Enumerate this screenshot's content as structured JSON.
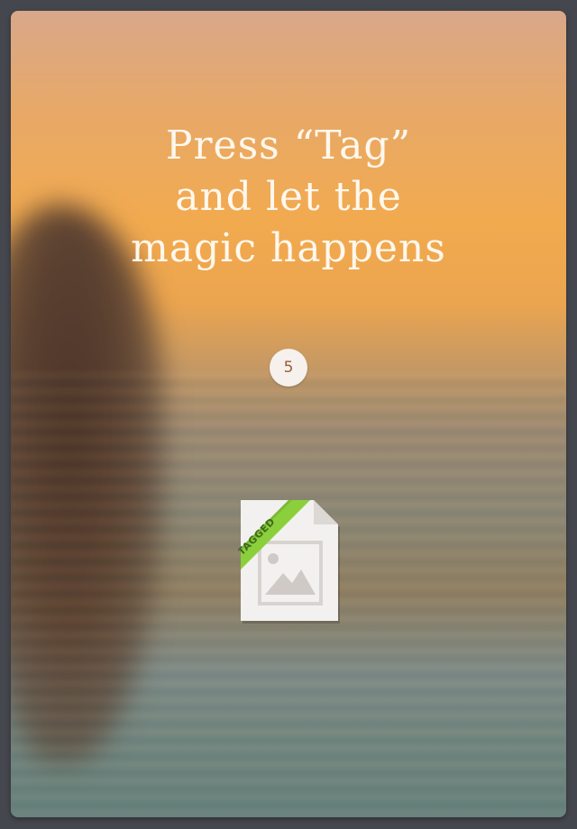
{
  "headline": {
    "line1": "Press “Tag”",
    "line2": "and let the",
    "line3": "magic happens"
  },
  "step": {
    "number": "5"
  },
  "file_icon": {
    "ribbon_label": "TAGGED",
    "icon": "tagged-image-file-icon",
    "ribbon_color": "#8ccf3c"
  }
}
